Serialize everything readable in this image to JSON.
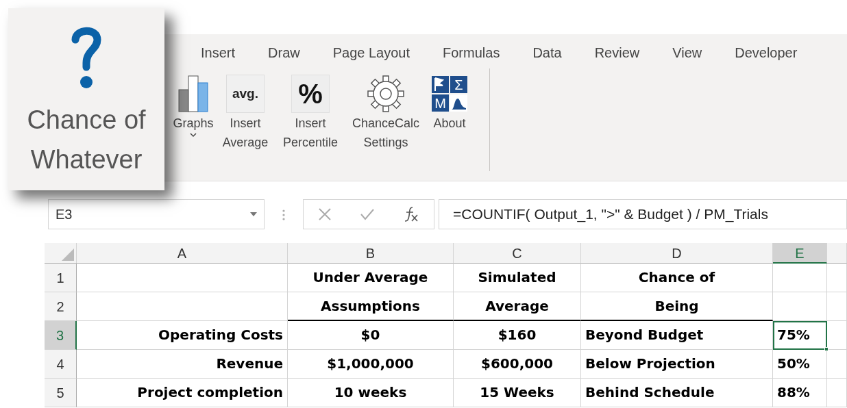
{
  "addin_panel": {
    "title": "Chance of Whatever"
  },
  "ribbon": {
    "tabs": [
      {
        "label": "Insert",
        "selected": false
      },
      {
        "label": "Draw",
        "selected": false
      },
      {
        "label": "Page Layout",
        "selected": false
      },
      {
        "label": "Formulas",
        "selected": false
      },
      {
        "label": "Data",
        "selected": false
      },
      {
        "label": "Review",
        "selected": false
      },
      {
        "label": "View",
        "selected": false
      },
      {
        "label": "Developer",
        "selected": false
      }
    ],
    "buttons": [
      {
        "kind": "graphs",
        "label": "Graphs",
        "dropdown": true
      },
      {
        "kind": "average",
        "label": "Insert Average",
        "icon_text": "avg."
      },
      {
        "kind": "percentile",
        "label": "Insert Percentile",
        "icon_text": "%"
      },
      {
        "kind": "settings",
        "label": "ChanceCalc Settings"
      },
      {
        "kind": "about",
        "label": "About",
        "icon_letters": [
          "Σ",
          "M"
        ]
      }
    ]
  },
  "formula_bar": {
    "name_box": "E3",
    "formula": "=COUNTIF( Output_1, \">\" & Budget ) / PM_Trials"
  },
  "sheet": {
    "columns": [
      {
        "label": "A",
        "selected": false
      },
      {
        "label": "B",
        "selected": false
      },
      {
        "label": "C",
        "selected": false
      },
      {
        "label": "D",
        "selected": false
      },
      {
        "label": "E",
        "selected": true
      }
    ],
    "rows": [
      {
        "label": "1",
        "selected": false,
        "cells": [
          {
            "text": "",
            "selected": false
          },
          {
            "text": "Under Average",
            "selected": false
          },
          {
            "text": "Simulated",
            "selected": false
          },
          {
            "text": "Chance of",
            "selected": false
          },
          {
            "text": "",
            "selected": false
          }
        ]
      },
      {
        "label": "2",
        "selected": false,
        "cells": [
          {
            "text": "",
            "selected": false
          },
          {
            "text": "Assumptions",
            "selected": false
          },
          {
            "text": "Average",
            "selected": false
          },
          {
            "text": "Being",
            "selected": false
          },
          {
            "text": "",
            "selected": false
          }
        ]
      },
      {
        "label": "3",
        "selected": true,
        "cells": [
          {
            "text": "Operating Costs",
            "selected": false
          },
          {
            "text": "$0",
            "selected": false
          },
          {
            "text": "$160",
            "selected": false
          },
          {
            "text": "Beyond Budget",
            "selected": false
          },
          {
            "text": "75%",
            "selected": true
          }
        ]
      },
      {
        "label": "4",
        "selected": false,
        "cells": [
          {
            "text": "Revenue",
            "selected": false
          },
          {
            "text": "$1,000,000",
            "selected": false
          },
          {
            "text": "$600,000",
            "selected": false
          },
          {
            "text": "Below Projection",
            "selected": false
          },
          {
            "text": "50%",
            "selected": false
          }
        ]
      },
      {
        "label": "5",
        "selected": false,
        "cells": [
          {
            "text": "Project completion",
            "selected": false
          },
          {
            "text": "10 weeks",
            "selected": false
          },
          {
            "text": "15 Weeks",
            "selected": false
          },
          {
            "text": "Behind Schedule",
            "selected": false
          },
          {
            "text": "88%",
            "selected": false
          }
        ]
      }
    ]
  }
}
